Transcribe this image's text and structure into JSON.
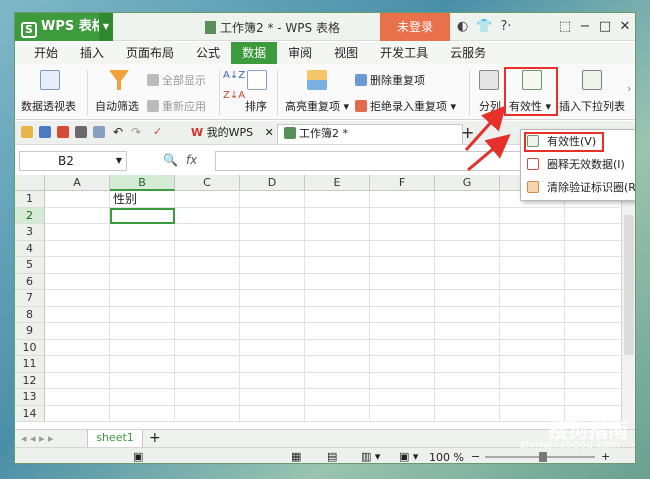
{
  "app": {
    "name": "WPS 表格",
    "doc_title": "工作簿2 * - WPS 表格",
    "login": "未登录",
    "title_icons": [
      "shirt-icon",
      "help-icon",
      "minimize-icon",
      "maximize-icon",
      "close-icon"
    ]
  },
  "menu_tabs": [
    "开始",
    "插入",
    "页面布局",
    "公式",
    "数据",
    "审阅",
    "视图",
    "开发工具",
    "云服务"
  ],
  "ribbon": {
    "pivot": "数据透视表",
    "autofilter": "自动筛选",
    "show_all": "全部显示",
    "reapply": "重新应用",
    "sort": "排序",
    "highlight_dup": "高亮重复项",
    "delete_dup": "删除重复项",
    "reject_dup": "拒绝录入重复项",
    "split": "分列",
    "validity": "有效性",
    "insert_dropdown": "插入下拉列表"
  },
  "doc_tabs": {
    "my_wps": "我的WPS",
    "workbook": "工作簿2 *"
  },
  "formula_bar": {
    "cell_ref": "B2",
    "fx": "fx"
  },
  "columns": [
    "A",
    "B",
    "C",
    "D",
    "E",
    "F",
    "G",
    "H",
    "I"
  ],
  "rows": [
    "1",
    "2",
    "3",
    "4",
    "5",
    "6",
    "7",
    "8",
    "9",
    "10",
    "11",
    "12",
    "13",
    "14"
  ],
  "cells": {
    "B1": "性别"
  },
  "dropdown_menu": [
    "有效性(V)",
    "圈释无效数据(I)",
    "清除验证标识圈(R)"
  ],
  "sheets": [
    "sheet1"
  ],
  "status": {
    "zoom": "100 %"
  },
  "watermark": {
    "brand": "搜狗指南",
    "url": "zhinan.sogou.com"
  },
  "colors": {
    "accent": "#3d9a3d",
    "login": "#e8704a",
    "highlight": "#e8302a"
  }
}
